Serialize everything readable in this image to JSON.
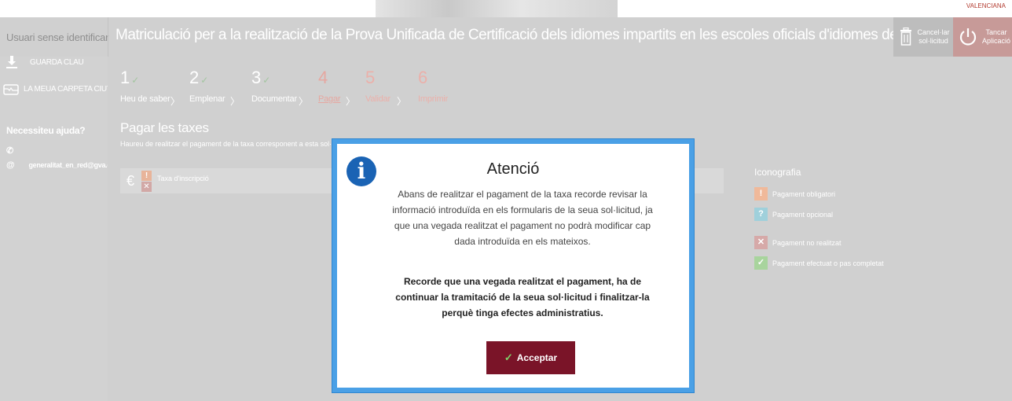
{
  "banner": {
    "logo_text": "VALENCIANA"
  },
  "header": {
    "user_label": "Usuari sense identificar",
    "title": "Matriculació per a la realització de la Prova Unificada de Certificació dels idiomes impartits en les escoles oficials d'idiomes de la Comunitat Valenciana",
    "cancel_label": "Cancel·lar\nsol·licitud",
    "close_label": "Tancar\nAplicació"
  },
  "sidebar": {
    "items": [
      {
        "label": "GUARDA CLAU",
        "icon": "download-icon"
      },
      {
        "label": "LA MEUA CARPETA CIUTADANA",
        "icon": "folder-icon"
      }
    ],
    "help_title": "Necessiteu ajuda?",
    "contacts": [
      {
        "icon": "phone-icon",
        "text": ""
      },
      {
        "icon": "at-icon",
        "text": "generalitat_en_red@gva.es"
      }
    ]
  },
  "steps": [
    {
      "number": "1",
      "label": "Heu de saber",
      "status": "done"
    },
    {
      "number": "2",
      "label": "Emplenar",
      "status": "done"
    },
    {
      "number": "3",
      "label": "Documentar",
      "status": "done"
    },
    {
      "number": "4",
      "label": "Pagar",
      "status": "active"
    },
    {
      "number": "5",
      "label": "Validar",
      "status": "pending"
    },
    {
      "number": "6",
      "label": "Imprimir",
      "status": "pending"
    }
  ],
  "step_check": "✓",
  "step_arrow": "〉",
  "section": {
    "title": "Pagar les taxes",
    "description": "Haureu de realitzar el pagament de la taxa corresponent a esta sol·licitud. Un",
    "fee_label": "Taxa d'inscripció",
    "euro_symbol": "€"
  },
  "legend": {
    "title": "Iconografia",
    "items": [
      {
        "symbol": "!",
        "label": "Pagament obligatori",
        "color": "#f0b99a"
      },
      {
        "symbol": "?",
        "label": "Pagament opcional",
        "color": "#9fd0db"
      },
      {
        "symbol": "✕",
        "label": "Pagament no realitzat",
        "color": "#d6a9a8"
      },
      {
        "symbol": "✓",
        "label": "Pagament efectuat o pas completat",
        "color": "#a8d49d"
      }
    ]
  },
  "modal": {
    "icon_text": "i",
    "title": "Atenció",
    "paragraph1": "Abans de realitzar el pagament de la taxa recorde revisar la informació introduïda en els formularis de la seua sol·licitud, ja que una vegada realitzat el pagament no podrà modificar cap dada introduïda en els mateixos.",
    "paragraph2": "Recorde que una vegada realitzat el pagament, ha de continuar la tramitació de la seua sol·licitud i finalitzar-la perquè tinga efectes administratius.",
    "accept_label": "Acceptar",
    "accept_icon": "✓"
  },
  "colors": {
    "accent": "#7a1428",
    "modal_border": "#4aa0e6",
    "info_icon": "#1a63b4"
  }
}
